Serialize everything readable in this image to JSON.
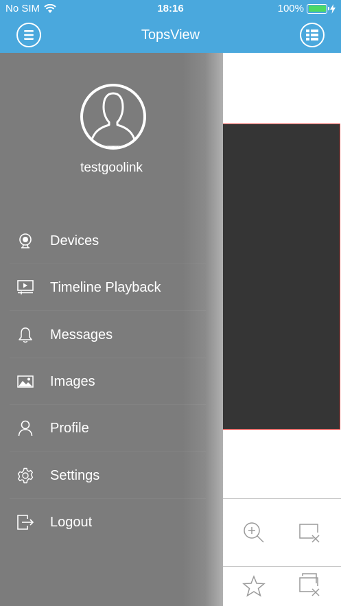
{
  "status": {
    "carrier": "No SIM",
    "time": "18:16",
    "battery_pct": "100%",
    "battery_level": 1.0
  },
  "nav": {
    "title": "TopsView",
    "left_icon": "menu-icon",
    "right_icon": "layout-icon"
  },
  "drawer": {
    "username": "testgoolink",
    "items": [
      {
        "label": "Devices",
        "icon": "webcam-icon"
      },
      {
        "label": "Timeline Playback",
        "icon": "playback-icon"
      },
      {
        "label": "Messages",
        "icon": "bell-icon"
      },
      {
        "label": "Images",
        "icon": "image-icon"
      },
      {
        "label": "Profile",
        "icon": "person-icon"
      },
      {
        "label": "Settings",
        "icon": "gear-icon"
      },
      {
        "label": "Logout",
        "icon": "logout-icon"
      }
    ]
  },
  "colors": {
    "header": "#4aa8dd",
    "drawer": "#7c7c7c",
    "video_bg": "#353535",
    "video_border": "#e53935"
  }
}
